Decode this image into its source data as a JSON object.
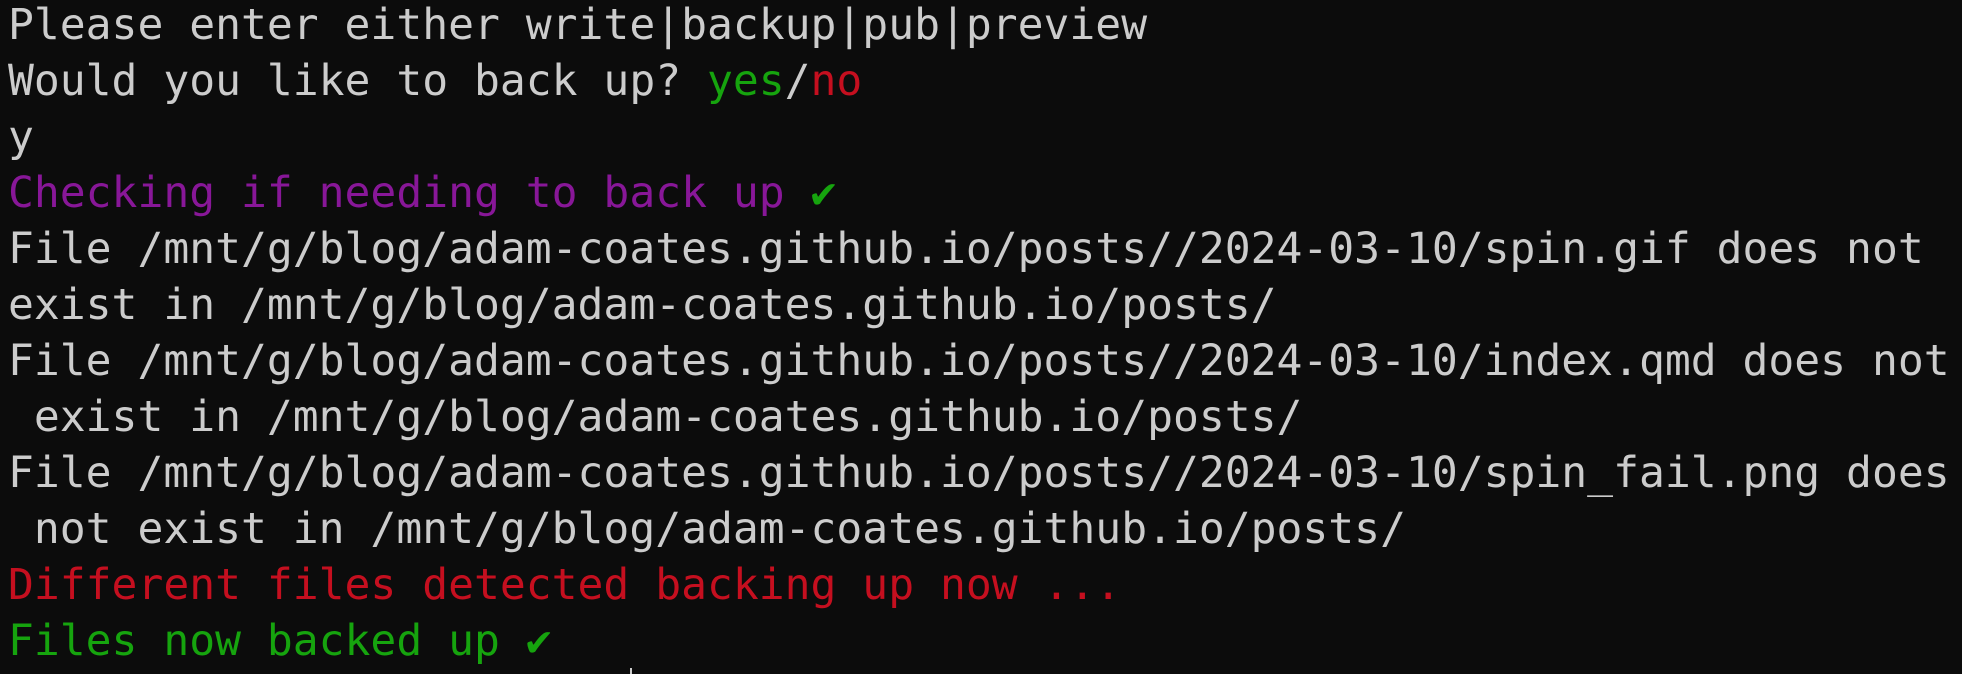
{
  "terminal": {
    "prompt_line": "Please enter either write|backup|pub|preview",
    "backup_question": {
      "text": "Would you like to back up? ",
      "yes": "yes",
      "slash": "/",
      "no": "no"
    },
    "user_input": "y",
    "checking": {
      "text": "Checking if needing to back up ",
      "check": "✔"
    },
    "file_lines": [
      "File /mnt/g/blog/adam-coates.github.io/posts//2024-03-10/spin.gif does not",
      "exist in /mnt/g/blog/adam-coates.github.io/posts/",
      "File /mnt/g/blog/adam-coates.github.io/posts//2024-03-10/index.qmd does not",
      " exist in /mnt/g/blog/adam-coates.github.io/posts/",
      "File /mnt/g/blog/adam-coates.github.io/posts//2024-03-10/spin_fail.png does",
      " not exist in /mnt/g/blog/adam-coates.github.io/posts/"
    ],
    "different_files": "Different files detected backing up now ...",
    "backed_up": {
      "text": "Files now backed up ",
      "check": "✔"
    }
  },
  "colors": {
    "background": "#0c0c0c",
    "foreground": "#cccccc",
    "green": "#16a40e",
    "red": "#c50f1f",
    "purple": "#881798"
  }
}
